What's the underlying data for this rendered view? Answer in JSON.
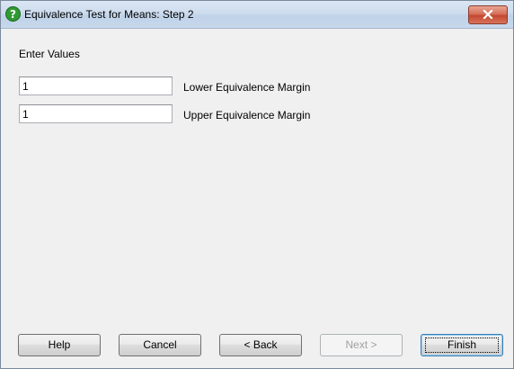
{
  "window": {
    "title": "Equivalence Test for Means: Step 2"
  },
  "form": {
    "section_label": "Enter Values",
    "fields": [
      {
        "value": "1",
        "label": "Lower Equivalence Margin"
      },
      {
        "value": "1",
        "label": "Upper Equivalence Margin"
      }
    ]
  },
  "buttons": {
    "help": "Help",
    "cancel": "Cancel",
    "back": "< Back",
    "next": "Next >",
    "finish": "Finish"
  },
  "icons": {
    "title_icon": "help-question-icon",
    "close_icon": "close-x-icon"
  },
  "colors": {
    "title_icon_green": "#2f9a33",
    "close_red": "#c4472f"
  }
}
